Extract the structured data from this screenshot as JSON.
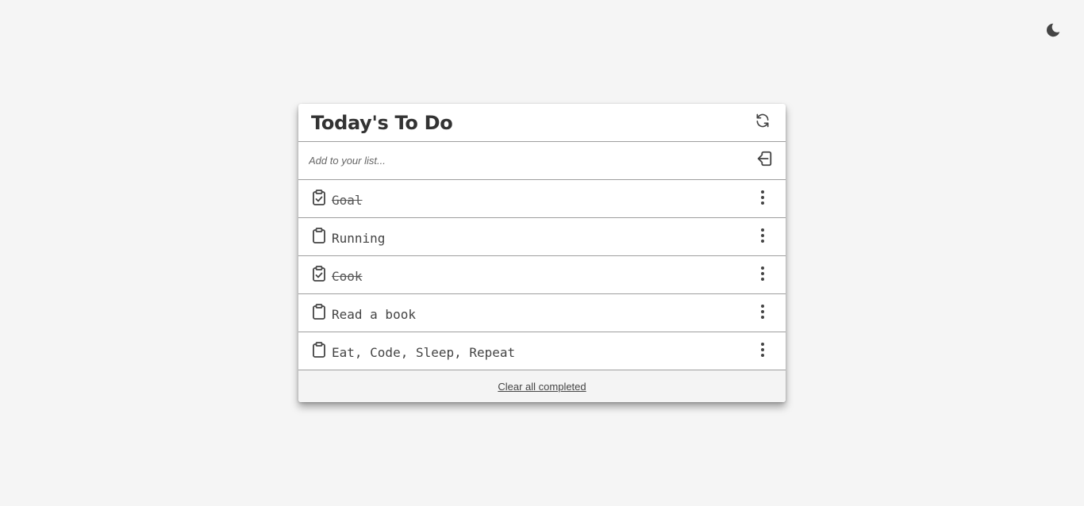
{
  "theme_toggle": {
    "icon": "moon-icon"
  },
  "card": {
    "title": "Today's To Do",
    "refresh_icon": "refresh-icon"
  },
  "add": {
    "placeholder": "Add to your list...",
    "value": "",
    "submit_icon": "enter-icon"
  },
  "todos": [
    {
      "text": "Goal",
      "completed": true
    },
    {
      "text": "Running",
      "completed": false
    },
    {
      "text": "Cook",
      "completed": true
    },
    {
      "text": "Read a book",
      "completed": false
    },
    {
      "text": "Eat, Code, Sleep, Repeat",
      "completed": false
    }
  ],
  "footer": {
    "clear_label": "Clear all completed"
  }
}
